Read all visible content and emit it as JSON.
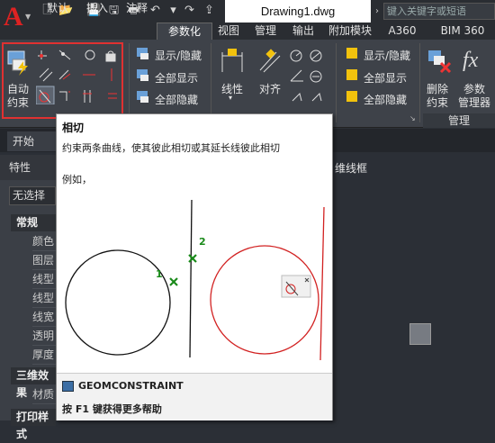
{
  "app": {
    "logo": "A",
    "doc_title": "Drawing1.dwg",
    "search_placeholder": "键入关键字或短语"
  },
  "quick_access": [
    "new-icon",
    "open-icon",
    "save-icon",
    "saveas-icon",
    "print-icon",
    "undo-icon",
    "redo-icon",
    "share-icon"
  ],
  "tabs": [
    {
      "label": "默认"
    },
    {
      "label": "插入"
    },
    {
      "label": "注释"
    },
    {
      "label": "参数化",
      "active": true
    },
    {
      "label": "视图"
    },
    {
      "label": "管理"
    },
    {
      "label": "输出"
    },
    {
      "label": "附加模块"
    },
    {
      "label": "A360"
    },
    {
      "label": "BIM 360"
    }
  ],
  "ribbon": {
    "auto_constrain": {
      "line1": "自动",
      "line2": "约束"
    },
    "geom_show_hide": "显示/隐藏",
    "geom_show_all": "全部显示",
    "geom_hide_all": "全部隐藏",
    "linear": "线性",
    "aligned": "对齐",
    "dim_show_hide": "显示/隐藏",
    "dim_show_all": "全部显示",
    "dim_hide_all": "全部隐藏",
    "delete_constraint": {
      "line1": "删除",
      "line2": "约束"
    },
    "param_manager": {
      "line1": "参数",
      "line2": "管理器"
    },
    "manage_panel": "管理"
  },
  "filetabs": {
    "start": "开始"
  },
  "properties": {
    "title": "特性",
    "selection": "无选择",
    "section_general": "常规",
    "rows": [
      "颜色",
      "图层",
      "线型",
      "线型",
      "线宽",
      "透明",
      "厚度"
    ],
    "section_3d": "三维效果",
    "row_material": "材质",
    "section_print": "打印样式"
  },
  "canvas": {
    "label": "维线框"
  },
  "tooltip": {
    "title": "相切",
    "description": "约束两条曲线，使其彼此相切或其延长线彼此相切",
    "example": "例如，",
    "fig_label_1": "1",
    "fig_label_2": "2",
    "command": "GEOMCONSTRAINT",
    "help": "按 F1 键获得更多帮助"
  },
  "colors": {
    "accent_red": "#e03131",
    "ribbon_bg": "#3e4249",
    "fig_green": "#1a8a1a",
    "fig_red": "#d22222"
  }
}
